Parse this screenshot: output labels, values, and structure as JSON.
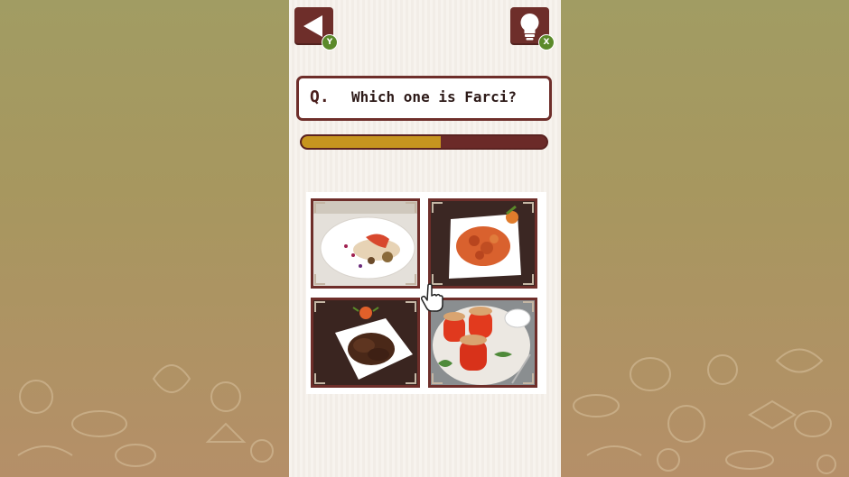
{
  "nav": {
    "back_button_icon": "triangle-left-icon",
    "back_button_hotkey": "Y",
    "hint_button_icon": "lightbulb-icon",
    "hint_button_hotkey": "X"
  },
  "question": {
    "prefix": "Q.",
    "text": "Which one is Farci?"
  },
  "progress": {
    "fraction": 0.57
  },
  "answers": [
    {
      "dish_icon": "plated-fish-dish"
    },
    {
      "dish_icon": "square-plate-stew-dish"
    },
    {
      "dish_icon": "braised-meat-dish"
    },
    {
      "dish_icon": "stuffed-peppers-dish"
    }
  ],
  "cursor_icon": "hand-pointer-icon",
  "colors": {
    "frame": "#6e2e2a",
    "progress_fill": "#c6951f",
    "progress_track": "#6b2a28",
    "badge": "#5b8a2a",
    "panel": "#f7f3ee"
  }
}
